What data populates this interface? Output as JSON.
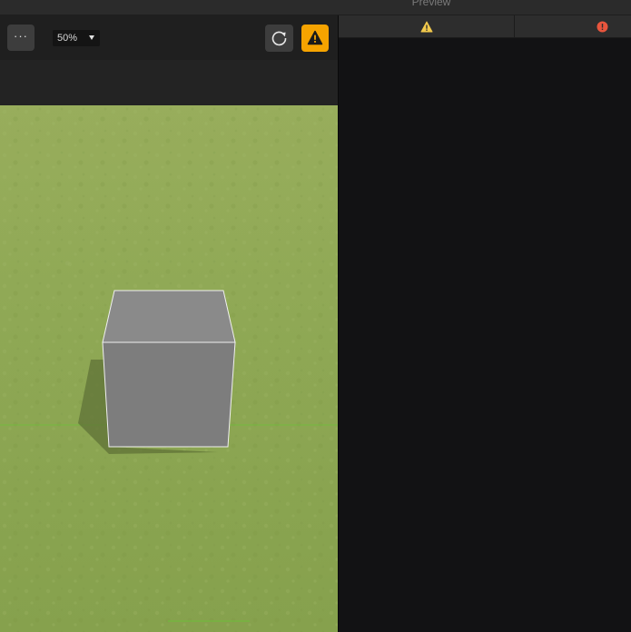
{
  "window": {
    "preview_title": "Preview"
  },
  "toolbar": {
    "more_label": "···",
    "zoom_value": "50%",
    "icons": {
      "more": "more-icon",
      "reload": "reload-icon",
      "warning": "warning-icon",
      "caret": "chevron-down-icon"
    },
    "accent_color": "#f5a300"
  },
  "scene": {
    "ground_color": "#8fa955",
    "cube_color": "#7d7d7d"
  },
  "console": {
    "tabs": [
      {
        "icon": "warning-icon",
        "color": "#f2c94c"
      },
      {
        "icon": "error-icon",
        "color": "#e8553d"
      }
    ]
  }
}
